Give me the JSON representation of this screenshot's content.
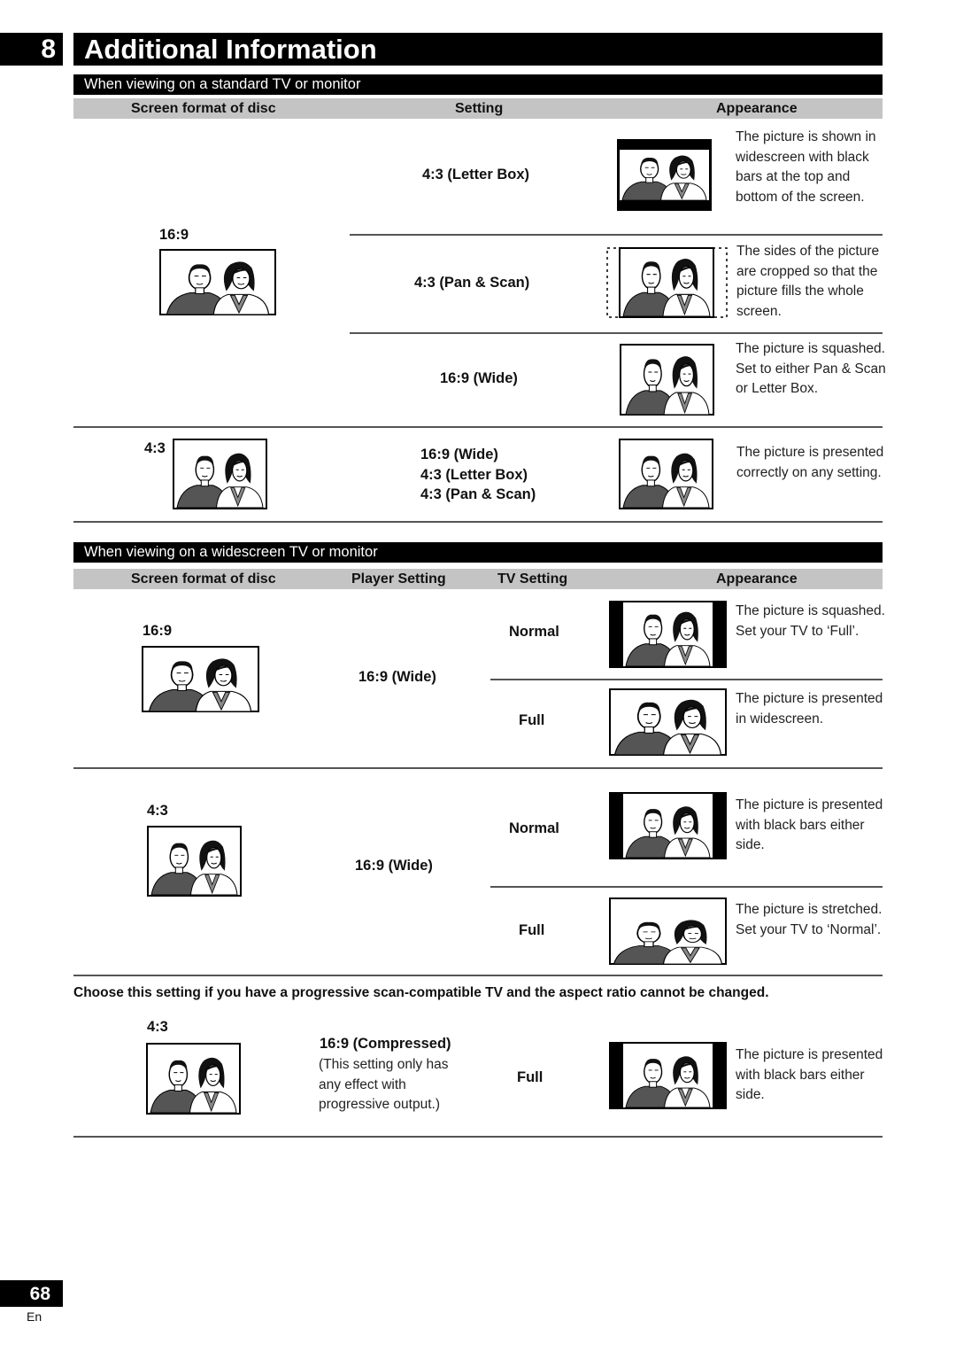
{
  "header": {
    "chapter_number": "8",
    "chapter_title": "Additional Information"
  },
  "standard_tv": {
    "section_title": "When viewing on a standard TV or monitor",
    "columns": [
      "Screen format of disc",
      "Setting",
      "Appearance"
    ],
    "rows": [
      {
        "disc_format": "16:9",
        "settings": [
          {
            "setting": "4:3 (Letter Box)",
            "appearance": "The picture is shown in widescreen with black bars at the top and bottom of the screen.",
            "picture": "letterbox-icon"
          },
          {
            "setting": "4:3 (Pan & Scan)",
            "appearance": "The sides of the picture are cropped so that the picture fills the whole screen.",
            "picture": "pan-scan-icon"
          },
          {
            "setting": "16:9 (Wide)",
            "appearance": "The picture is squashed. Set to either Pan & Scan or Letter Box.",
            "picture": "squashed-icon"
          }
        ]
      },
      {
        "disc_format": "4:3",
        "settings_list": [
          "16:9 (Wide)",
          "4:3 (Letter Box)",
          "4:3 (Pan & Scan)"
        ],
        "appearance": "The picture is presented correctly on any setting.",
        "picture": "normal-icon"
      }
    ]
  },
  "widescreen_tv": {
    "section_title": "When viewing on a widescreen TV or monitor",
    "columns": [
      "Screen format of disc",
      "Player Setting",
      "TV Setting",
      "Appearance"
    ],
    "rows": [
      {
        "disc_format": "16:9",
        "player_setting": "16:9 (Wide)",
        "tv_settings": [
          {
            "tv_setting": "Normal",
            "appearance": "The picture is squashed. Set your TV to ‘Full’."
          },
          {
            "tv_setting": "Full",
            "appearance": "The picture is presented in widescreen."
          }
        ]
      },
      {
        "disc_format": "4:3",
        "player_setting": "16:9 (Wide)",
        "tv_settings": [
          {
            "tv_setting": "Normal",
            "appearance": "The picture is presented with black bars either side."
          },
          {
            "tv_setting": "Full",
            "appearance": "The picture is stretched. Set your TV to ‘Normal’."
          }
        ]
      }
    ],
    "progressive_note": "Choose this setting if you have a progressive scan-compatible TV and the aspect ratio cannot be changed.",
    "progressive_row": {
      "disc_format": "4:3",
      "player_setting": "16:9 (Compressed)",
      "player_note_lines": [
        "(This setting only has",
        "any effect with",
        "progressive output.)"
      ],
      "tv_setting": "Full",
      "appearance": "The picture is presented with black bars either side."
    }
  },
  "footer": {
    "page_number": "68",
    "language": "En"
  }
}
